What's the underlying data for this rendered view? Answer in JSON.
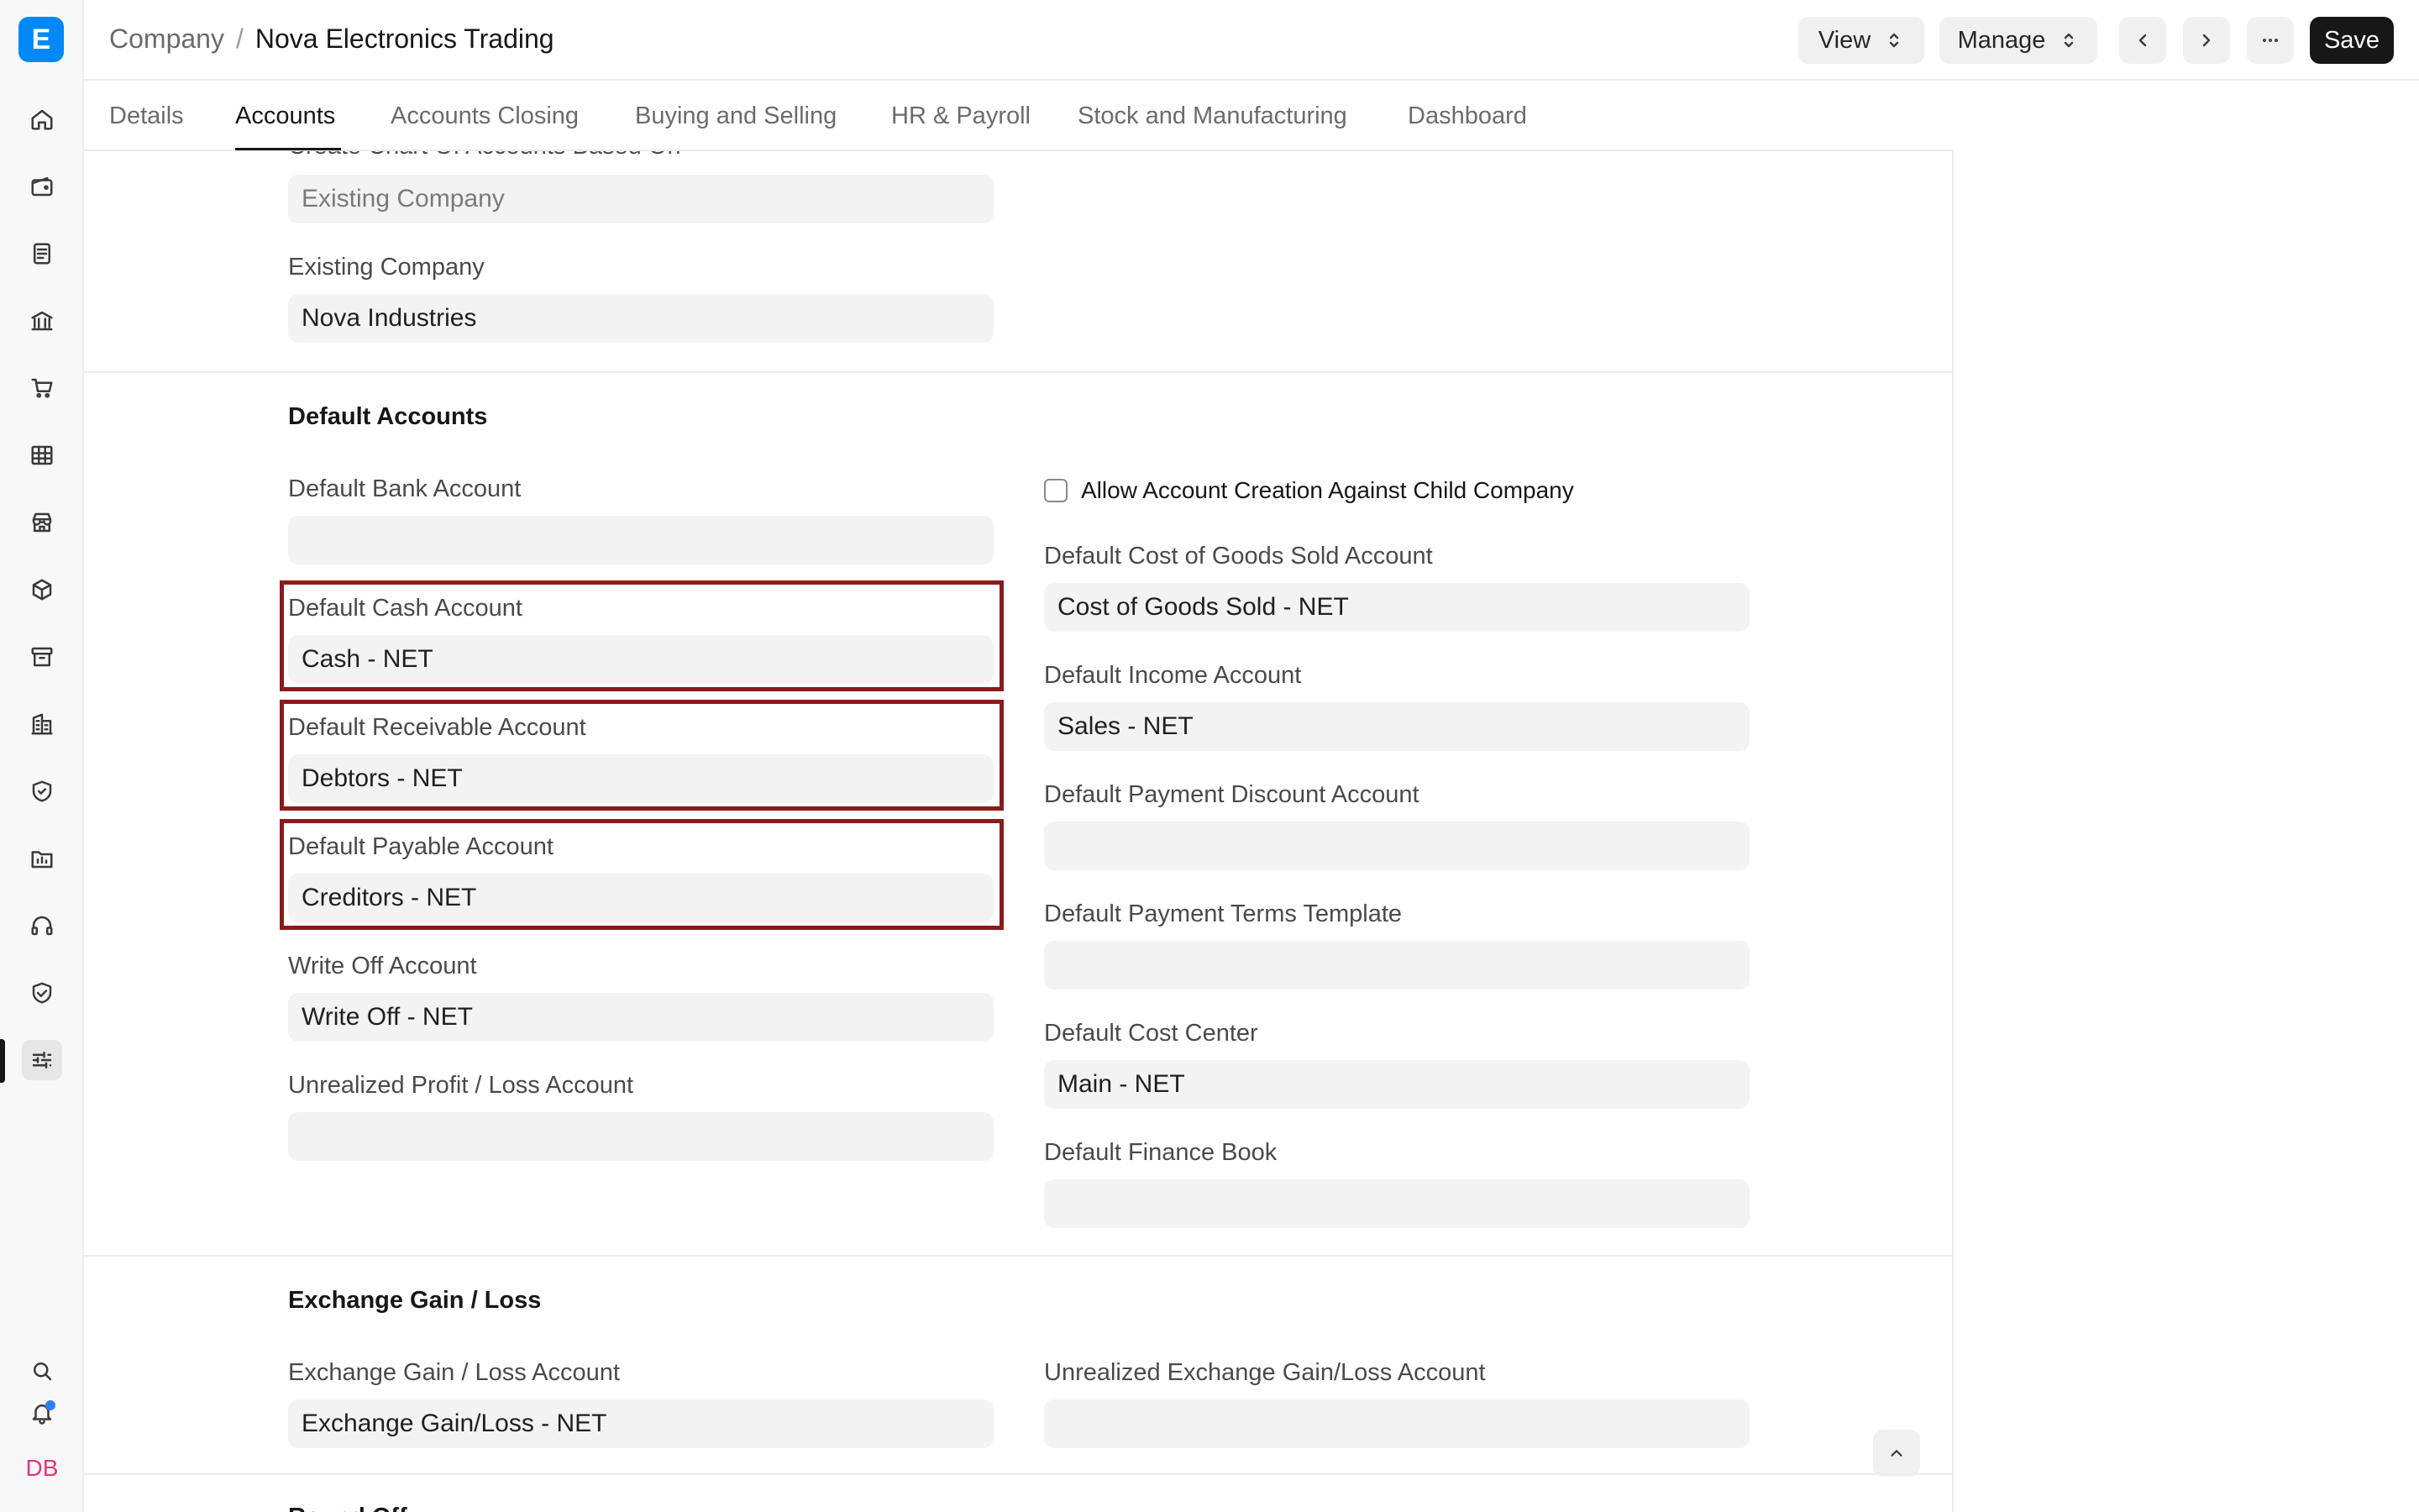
{
  "app": {
    "logo_letter": "E"
  },
  "breadcrumb": {
    "parent": "Company",
    "separator": "/",
    "current": "Nova Electronics Trading"
  },
  "header_buttons": {
    "view": "View",
    "manage": "Manage",
    "save": "Save"
  },
  "sidebar": {
    "icons": [
      "home-icon",
      "wallet-icon",
      "document-list-icon",
      "bank-icon",
      "cart-icon",
      "table-grid-icon",
      "store-icon",
      "box-icon",
      "archive-icon",
      "buildings-icon",
      "shield-icon",
      "folder-chart-icon",
      "headset-icon",
      "handshake-shield-icon",
      "settings-sliders-icon"
    ],
    "active_icon": "settings-sliders-icon",
    "avatar_initials": "DB"
  },
  "tabs": [
    {
      "label": "Details",
      "active": false
    },
    {
      "label": "Accounts",
      "active": true
    },
    {
      "label": "Accounts Closing",
      "active": false
    },
    {
      "label": "Buying and Selling",
      "active": false
    },
    {
      "label": "HR & Payroll",
      "active": false
    },
    {
      "label": "Stock and Manufacturing",
      "active": false
    },
    {
      "label": "Dashboard",
      "active": false
    }
  ],
  "form": {
    "chart_of_accounts": {
      "label": "Create Chart Of Accounts Based On",
      "value": "Existing Company"
    },
    "existing_company": {
      "label": "Existing Company",
      "value": "Nova Industries"
    },
    "default_accounts": {
      "title": "Default Accounts",
      "left": [
        {
          "label": "Default Bank Account",
          "value": ""
        },
        {
          "label": "Default Cash Account",
          "value": "Cash - NET"
        },
        {
          "label": "Default Receivable Account",
          "value": "Debtors - NET"
        },
        {
          "label": "Default Payable Account",
          "value": "Creditors - NET"
        },
        {
          "label": "Write Off Account",
          "value": "Write Off - NET"
        },
        {
          "label": "Unrealized Profit / Loss Account",
          "value": ""
        }
      ],
      "checkbox": {
        "label": "Allow Account Creation Against Child Company",
        "checked": false
      },
      "right": [
        {
          "label": "Default Cost of Goods Sold Account",
          "value": "Cost of Goods Sold - NET"
        },
        {
          "label": "Default Income Account",
          "value": "Sales - NET"
        },
        {
          "label": "Default Payment Discount Account",
          "value": ""
        },
        {
          "label": "Default Payment Terms Template",
          "value": ""
        },
        {
          "label": "Default Cost Center",
          "value": "Main - NET"
        },
        {
          "label": "Default Finance Book",
          "value": ""
        }
      ]
    },
    "exchange": {
      "title": "Exchange Gain / Loss",
      "left": {
        "label": "Exchange Gain / Loss Account",
        "value": "Exchange Gain/Loss - NET"
      },
      "right": {
        "label": "Unrealized Exchange Gain/Loss Account",
        "value": ""
      }
    },
    "next_section_title": "Round Off"
  },
  "colors": {
    "highlight": "#8b1a1a",
    "logo": "#0289f7",
    "save_button": "#171717",
    "avatar_text": "#e0367f",
    "notification_dot": "#2d7ff9"
  }
}
